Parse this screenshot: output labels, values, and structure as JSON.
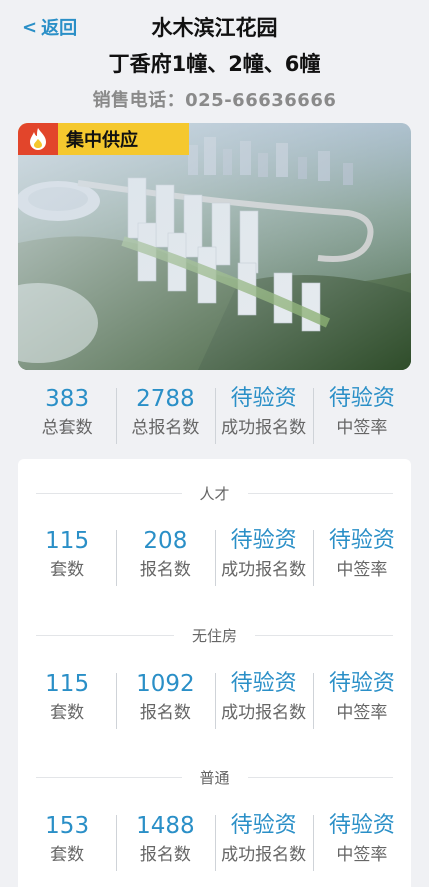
{
  "header": {
    "back_label": "返回",
    "title_line1": "水木滨江花园",
    "title_line2": "丁香府1幢、2幢、6幢",
    "phone": "销售电话：025-66636666"
  },
  "hero": {
    "badge": "集中供应",
    "icon": "fire-icon"
  },
  "summary": {
    "total_units": "383",
    "total_units_label": "总套数",
    "total_applicants": "2788",
    "total_applicants_label": "总报名数",
    "success_value": "待验资",
    "success_label": "成功报名数",
    "rate_value": "待验资",
    "rate_label": "中签率"
  },
  "sections": [
    {
      "name": "人才",
      "units": "115",
      "units_label": "套数",
      "applicants": "208",
      "applicants_label": "报名数",
      "success_value": "待验资",
      "success_label": "成功报名数",
      "rate_value": "待验资",
      "rate_label": "中签率"
    },
    {
      "name": "无住房",
      "units": "115",
      "units_label": "套数",
      "applicants": "1092",
      "applicants_label": "报名数",
      "success_value": "待验资",
      "success_label": "成功报名数",
      "rate_value": "待验资",
      "rate_label": "中签率"
    },
    {
      "name": "普通",
      "units": "153",
      "units_label": "套数",
      "applicants": "1488",
      "applicants_label": "报名数",
      "success_value": "待验资",
      "success_label": "成功报名数",
      "rate_value": "待验资",
      "rate_label": "中签率"
    }
  ],
  "colors": {
    "accent": "#2a8fc7",
    "badge_bg": "#f5c82e",
    "badge_icon_bg": "#e2452b"
  }
}
